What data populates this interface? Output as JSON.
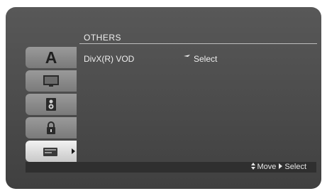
{
  "menu": {
    "title": "OTHERS",
    "tabs": [
      {
        "icon": "letter-a-icon",
        "label": "A"
      },
      {
        "icon": "display-icon"
      },
      {
        "icon": "speaker-icon"
      },
      {
        "icon": "lock-icon"
      },
      {
        "icon": "others-icon",
        "active": true
      }
    ],
    "items": [
      {
        "label": "DivX(R) VOD",
        "value": "Select"
      }
    ]
  },
  "footer": {
    "move_label": "Move",
    "select_label": "Select"
  },
  "colors": {
    "screen": "#4a4a4a",
    "active_tab": "#e8e8e8",
    "tab": "#8a8a8a",
    "text": "#eeeeee"
  }
}
